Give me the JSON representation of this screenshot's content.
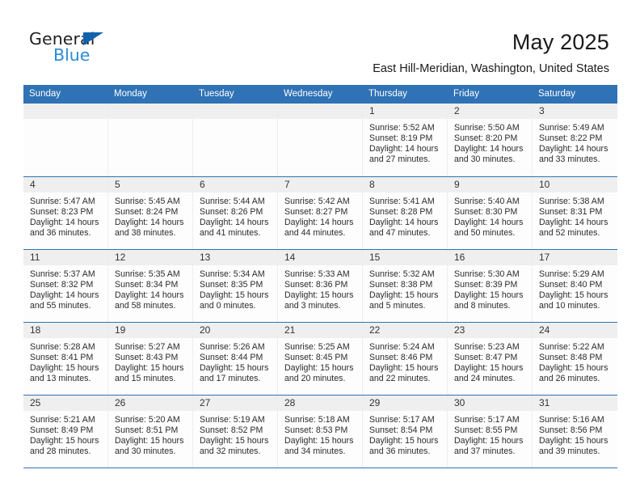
{
  "brand": {
    "name_part1": "General",
    "name_part2": "Blue",
    "flag_icon": "blue-triangle-flag"
  },
  "header": {
    "month_title": "May 2025",
    "location": "East Hill-Meridian, Washington, United States"
  },
  "colors": {
    "header_blue": "#2f72b6",
    "brand_blue": "#2a8bd5",
    "flag_blue": "#1263ae",
    "daynum_bg": "#efefef",
    "cell_divider": "#eceded"
  },
  "calendar": {
    "weekday_headers": [
      "Sunday",
      "Monday",
      "Tuesday",
      "Wednesday",
      "Thursday",
      "Friday",
      "Saturday"
    ],
    "weeks": [
      [
        {
          "day": "",
          "empty": true
        },
        {
          "day": "",
          "empty": true
        },
        {
          "day": "",
          "empty": true
        },
        {
          "day": "",
          "empty": true
        },
        {
          "day": "1",
          "sunrise": "Sunrise: 5:52 AM",
          "sunset": "Sunset: 8:19 PM",
          "daylight": "Daylight: 14 hours and 27 minutes."
        },
        {
          "day": "2",
          "sunrise": "Sunrise: 5:50 AM",
          "sunset": "Sunset: 8:20 PM",
          "daylight": "Daylight: 14 hours and 30 minutes."
        },
        {
          "day": "3",
          "sunrise": "Sunrise: 5:49 AM",
          "sunset": "Sunset: 8:22 PM",
          "daylight": "Daylight: 14 hours and 33 minutes."
        }
      ],
      [
        {
          "day": "4",
          "sunrise": "Sunrise: 5:47 AM",
          "sunset": "Sunset: 8:23 PM",
          "daylight": "Daylight: 14 hours and 36 minutes."
        },
        {
          "day": "5",
          "sunrise": "Sunrise: 5:45 AM",
          "sunset": "Sunset: 8:24 PM",
          "daylight": "Daylight: 14 hours and 38 minutes."
        },
        {
          "day": "6",
          "sunrise": "Sunrise: 5:44 AM",
          "sunset": "Sunset: 8:26 PM",
          "daylight": "Daylight: 14 hours and 41 minutes."
        },
        {
          "day": "7",
          "sunrise": "Sunrise: 5:42 AM",
          "sunset": "Sunset: 8:27 PM",
          "daylight": "Daylight: 14 hours and 44 minutes."
        },
        {
          "day": "8",
          "sunrise": "Sunrise: 5:41 AM",
          "sunset": "Sunset: 8:28 PM",
          "daylight": "Daylight: 14 hours and 47 minutes."
        },
        {
          "day": "9",
          "sunrise": "Sunrise: 5:40 AM",
          "sunset": "Sunset: 8:30 PM",
          "daylight": "Daylight: 14 hours and 50 minutes."
        },
        {
          "day": "10",
          "sunrise": "Sunrise: 5:38 AM",
          "sunset": "Sunset: 8:31 PM",
          "daylight": "Daylight: 14 hours and 52 minutes."
        }
      ],
      [
        {
          "day": "11",
          "sunrise": "Sunrise: 5:37 AM",
          "sunset": "Sunset: 8:32 PM",
          "daylight": "Daylight: 14 hours and 55 minutes."
        },
        {
          "day": "12",
          "sunrise": "Sunrise: 5:35 AM",
          "sunset": "Sunset: 8:34 PM",
          "daylight": "Daylight: 14 hours and 58 minutes."
        },
        {
          "day": "13",
          "sunrise": "Sunrise: 5:34 AM",
          "sunset": "Sunset: 8:35 PM",
          "daylight": "Daylight: 15 hours and 0 minutes."
        },
        {
          "day": "14",
          "sunrise": "Sunrise: 5:33 AM",
          "sunset": "Sunset: 8:36 PM",
          "daylight": "Daylight: 15 hours and 3 minutes."
        },
        {
          "day": "15",
          "sunrise": "Sunrise: 5:32 AM",
          "sunset": "Sunset: 8:38 PM",
          "daylight": "Daylight: 15 hours and 5 minutes."
        },
        {
          "day": "16",
          "sunrise": "Sunrise: 5:30 AM",
          "sunset": "Sunset: 8:39 PM",
          "daylight": "Daylight: 15 hours and 8 minutes."
        },
        {
          "day": "17",
          "sunrise": "Sunrise: 5:29 AM",
          "sunset": "Sunset: 8:40 PM",
          "daylight": "Daylight: 15 hours and 10 minutes."
        }
      ],
      [
        {
          "day": "18",
          "sunrise": "Sunrise: 5:28 AM",
          "sunset": "Sunset: 8:41 PM",
          "daylight": "Daylight: 15 hours and 13 minutes."
        },
        {
          "day": "19",
          "sunrise": "Sunrise: 5:27 AM",
          "sunset": "Sunset: 8:43 PM",
          "daylight": "Daylight: 15 hours and 15 minutes."
        },
        {
          "day": "20",
          "sunrise": "Sunrise: 5:26 AM",
          "sunset": "Sunset: 8:44 PM",
          "daylight": "Daylight: 15 hours and 17 minutes."
        },
        {
          "day": "21",
          "sunrise": "Sunrise: 5:25 AM",
          "sunset": "Sunset: 8:45 PM",
          "daylight": "Daylight: 15 hours and 20 minutes."
        },
        {
          "day": "22",
          "sunrise": "Sunrise: 5:24 AM",
          "sunset": "Sunset: 8:46 PM",
          "daylight": "Daylight: 15 hours and 22 minutes."
        },
        {
          "day": "23",
          "sunrise": "Sunrise: 5:23 AM",
          "sunset": "Sunset: 8:47 PM",
          "daylight": "Daylight: 15 hours and 24 minutes."
        },
        {
          "day": "24",
          "sunrise": "Sunrise: 5:22 AM",
          "sunset": "Sunset: 8:48 PM",
          "daylight": "Daylight: 15 hours and 26 minutes."
        }
      ],
      [
        {
          "day": "25",
          "sunrise": "Sunrise: 5:21 AM",
          "sunset": "Sunset: 8:49 PM",
          "daylight": "Daylight: 15 hours and 28 minutes."
        },
        {
          "day": "26",
          "sunrise": "Sunrise: 5:20 AM",
          "sunset": "Sunset: 8:51 PM",
          "daylight": "Daylight: 15 hours and 30 minutes."
        },
        {
          "day": "27",
          "sunrise": "Sunrise: 5:19 AM",
          "sunset": "Sunset: 8:52 PM",
          "daylight": "Daylight: 15 hours and 32 minutes."
        },
        {
          "day": "28",
          "sunrise": "Sunrise: 5:18 AM",
          "sunset": "Sunset: 8:53 PM",
          "daylight": "Daylight: 15 hours and 34 minutes."
        },
        {
          "day": "29",
          "sunrise": "Sunrise: 5:17 AM",
          "sunset": "Sunset: 8:54 PM",
          "daylight": "Daylight: 15 hours and 36 minutes."
        },
        {
          "day": "30",
          "sunrise": "Sunrise: 5:17 AM",
          "sunset": "Sunset: 8:55 PM",
          "daylight": "Daylight: 15 hours and 37 minutes."
        },
        {
          "day": "31",
          "sunrise": "Sunrise: 5:16 AM",
          "sunset": "Sunset: 8:56 PM",
          "daylight": "Daylight: 15 hours and 39 minutes."
        }
      ]
    ]
  }
}
